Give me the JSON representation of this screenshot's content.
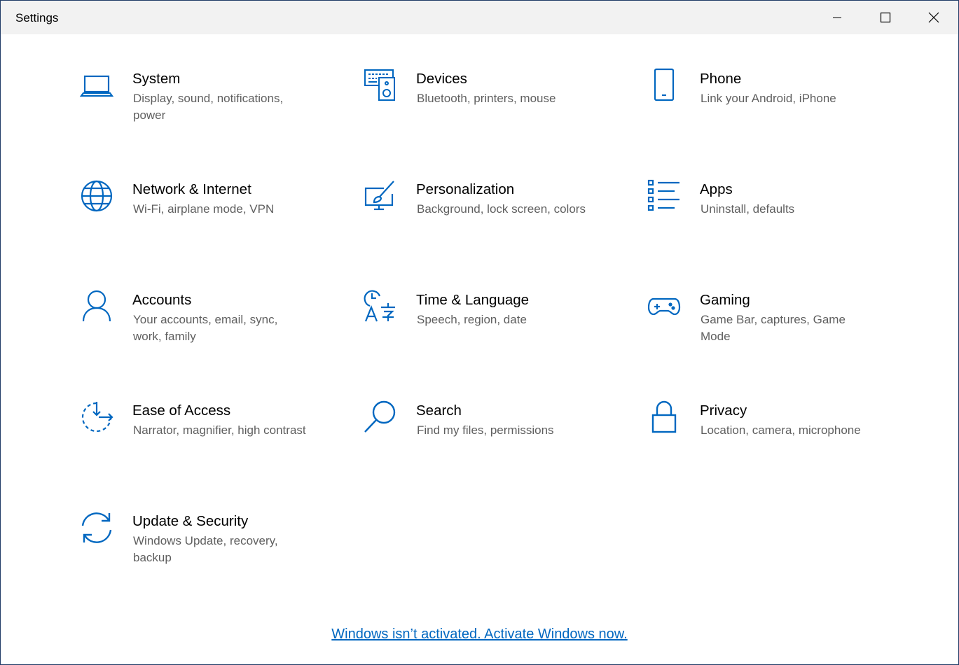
{
  "window": {
    "title": "Settings",
    "controls": [
      "minimize",
      "maximize",
      "close"
    ]
  },
  "accent_color": "#0067c0",
  "tiles": [
    {
      "name": "System",
      "desc": "Display, sound, notifications, power",
      "icon": "laptop-icon"
    },
    {
      "name": "Devices",
      "desc": "Bluetooth, printers, mouse",
      "icon": "keyboard-speaker-icon"
    },
    {
      "name": "Phone",
      "desc": "Link your Android, iPhone",
      "icon": "phone-icon"
    },
    {
      "name": "Network & Internet",
      "desc": "Wi-Fi, airplane mode, VPN",
      "icon": "globe-icon"
    },
    {
      "name": "Personalization",
      "desc": "Background, lock screen, colors",
      "icon": "paint-brush-icon"
    },
    {
      "name": "Apps",
      "desc": "Uninstall, defaults",
      "icon": "app-list-icon"
    },
    {
      "name": "Accounts",
      "desc": "Your accounts, email, sync, work, family",
      "icon": "person-icon"
    },
    {
      "name": "Time & Language",
      "desc": "Speech, region, date",
      "icon": "time-language-icon"
    },
    {
      "name": "Gaming",
      "desc": "Game Bar, captures, Game Mode",
      "icon": "gamepad-icon"
    },
    {
      "name": "Ease of Access",
      "desc": "Narrator, magnifier, high contrast",
      "icon": "ease-of-access-icon"
    },
    {
      "name": "Search",
      "desc": "Find my files, permissions",
      "icon": "magnifier-icon"
    },
    {
      "name": "Privacy",
      "desc": "Location, camera, microphone",
      "icon": "lock-icon"
    },
    {
      "name": "Update & Security",
      "desc": "Windows Update, recovery, backup",
      "icon": "sync-arrows-icon"
    }
  ],
  "activation_link": "Windows isn’t activated. Activate Windows now."
}
